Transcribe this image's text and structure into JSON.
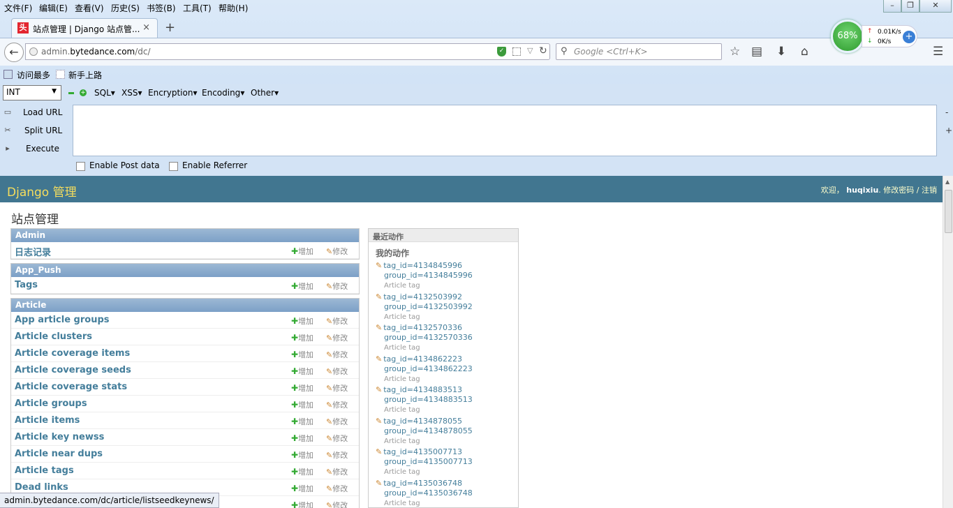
{
  "menu": [
    "文件(F)",
    "编辑(E)",
    "查看(V)",
    "历史(S)",
    "书签(B)",
    "工具(T)",
    "帮助(H)"
  ],
  "tab": {
    "favicon": "头",
    "title": "站点管理 | Django 站点管...",
    "close": "×",
    "new": "+"
  },
  "url": {
    "domain_prefix": "admin.",
    "domain": "bytedance.com",
    "path": "/dc/"
  },
  "search_placeholder": "Google <Ctrl+K>",
  "gauge": "68%",
  "speed": {
    "up": "0.01K/s",
    "down": "0K/s"
  },
  "bookmarks": [
    "访问最多",
    "新手上路"
  ],
  "hackbar": {
    "select": "INT",
    "menus": [
      "SQL",
      "XSS",
      "Encryption",
      "Encoding",
      "Other"
    ],
    "buttons": [
      "Load URL",
      "Split URL",
      "Execute"
    ],
    "checks": [
      "Enable Post data",
      "Enable Referrer"
    ]
  },
  "django": {
    "brand": "Django 管理",
    "welcome": "欢迎，",
    "user": "huqixiu",
    "sep1": ".",
    "change_pw": "修改密码",
    "sep2": "/",
    "logout": "注销"
  },
  "page_title": "站点管理",
  "add_label": "增加",
  "change_label": "修改",
  "modules": [
    {
      "caption": "Admin",
      "rows": [
        "日志记录"
      ]
    },
    {
      "caption": "App_Push",
      "rows": [
        "Tags"
      ]
    },
    {
      "caption": "Article",
      "rows": [
        "App article groups",
        "Article clusters",
        "Article coverage items",
        "Article coverage seeds",
        "Article coverage stats",
        "Article groups",
        "Article items",
        "Article key newss",
        "Article near dups",
        "Article tags",
        "Dead links",
        ""
      ]
    }
  ],
  "recent": {
    "caption": "最近动作",
    "mine": "我的动作",
    "actions": [
      {
        "l1": "tag_id=4134845996",
        "l2": "group_id=4134845996",
        "type": "Article tag"
      },
      {
        "l1": "tag_id=4132503992",
        "l2": "group_id=4132503992",
        "type": "Article tag"
      },
      {
        "l1": "tag_id=4132570336",
        "l2": "group_id=4132570336",
        "type": "Article tag"
      },
      {
        "l1": "tag_id=4134862223",
        "l2": "group_id=4134862223",
        "type": "Article tag"
      },
      {
        "l1": "tag_id=4134883513",
        "l2": "group_id=4134883513",
        "type": "Article tag"
      },
      {
        "l1": "tag_id=4134878055",
        "l2": "group_id=4134878055",
        "type": "Article tag"
      },
      {
        "l1": "tag_id=4135007713",
        "l2": "group_id=4135007713",
        "type": "Article tag"
      },
      {
        "l1": "tag_id=4135036748",
        "l2": "group_id=4135036748",
        "type": "Article tag"
      }
    ]
  },
  "status_url": "admin.bytedance.com/dc/article/listseedkeynews/",
  "colors": {
    "header": "#417690",
    "brand": "#f5dd5d",
    "link": "#447e9b",
    "caption": "#7ca0c7"
  }
}
